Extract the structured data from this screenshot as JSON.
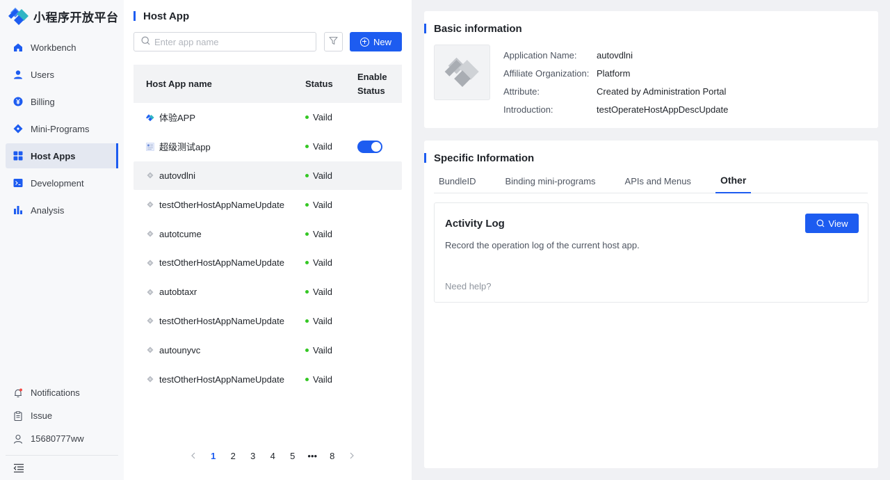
{
  "brand": {
    "title": "小程序开放平台",
    "accent": "#1d5cf0"
  },
  "sidebar": {
    "items": [
      {
        "label": "Workbench",
        "icon": "home-icon"
      },
      {
        "label": "Users",
        "icon": "user-icon"
      },
      {
        "label": "Billing",
        "icon": "yuan-icon"
      },
      {
        "label": "Mini-Programs",
        "icon": "diamond-icon"
      },
      {
        "label": "Host Apps",
        "icon": "grid-icon",
        "active": true
      },
      {
        "label": "Development",
        "icon": "terminal-icon"
      },
      {
        "label": "Analysis",
        "icon": "bar-chart-icon"
      }
    ],
    "bottom": {
      "notifications": "Notifications",
      "issue": "Issue",
      "user": "15680777ww"
    }
  },
  "list": {
    "title": "Host App",
    "search_placeholder": "Enter app name",
    "new_label": "New",
    "columns": {
      "name": "Host App name",
      "status": "Status",
      "enable": "Enable Status"
    },
    "rows": [
      {
        "name": "体验APP",
        "status": "Vaild",
        "toggle": false
      },
      {
        "name": "超级测试app",
        "status": "Vaild",
        "toggle": true
      },
      {
        "name": "autovdlni",
        "status": "Vaild",
        "toggle": false,
        "selected": true
      },
      {
        "name": "testOtherHostAppNameUpdate",
        "status": "Vaild",
        "toggle": false
      },
      {
        "name": "autotcume",
        "status": "Vaild",
        "toggle": false
      },
      {
        "name": "testOtherHostAppNameUpdate",
        "status": "Vaild",
        "toggle": false
      },
      {
        "name": "autobtaxr",
        "status": "Vaild",
        "toggle": false
      },
      {
        "name": "testOtherHostAppNameUpdate",
        "status": "Vaild",
        "toggle": false
      },
      {
        "name": "autounyvc",
        "status": "Vaild",
        "toggle": false
      },
      {
        "name": "testOtherHostAppNameUpdate",
        "status": "Vaild",
        "toggle": false
      }
    ],
    "pagination": {
      "pages": [
        "1",
        "2",
        "3",
        "4",
        "5",
        "•••",
        "8"
      ],
      "current": "1"
    }
  },
  "basic": {
    "title": "Basic information",
    "fields": [
      {
        "label": "Application Name:",
        "value": "autovdlni"
      },
      {
        "label": "Affiliate Organization:",
        "value": "Platform"
      },
      {
        "label": "Attribute:",
        "value": "Created by Administration Portal"
      },
      {
        "label": "Introduction:",
        "value": "testOperateHostAppDescUpdate"
      }
    ]
  },
  "specific": {
    "title": "Specific Information",
    "tabs": [
      {
        "label": "BundleID"
      },
      {
        "label": "Binding mini-programs"
      },
      {
        "label": "APIs and Menus"
      },
      {
        "label": "Other",
        "active": true
      }
    ],
    "activity": {
      "title": "Activity Log",
      "description": "Record the operation log of the current host app.",
      "help": "Need help?",
      "view_label": "View"
    }
  }
}
